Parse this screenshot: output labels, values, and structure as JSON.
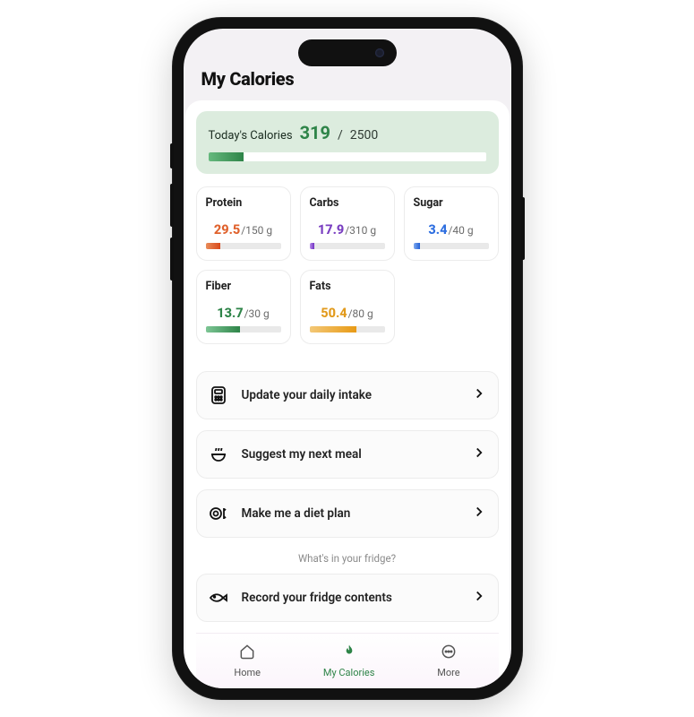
{
  "header": {
    "title": "My Calories"
  },
  "calories": {
    "label": "Today's Calories",
    "value": "319",
    "separator": "/",
    "total": "2500",
    "percent": 12.8
  },
  "nutrients": [
    {
      "name": "Protein",
      "current": "29.5",
      "target": "150",
      "unit": "g",
      "percent": 20,
      "color": "c-orange"
    },
    {
      "name": "Carbs",
      "current": "17.9",
      "target": "310",
      "unit": "g",
      "percent": 6,
      "color": "c-purple"
    },
    {
      "name": "Sugar",
      "current": "3.4",
      "target": "40",
      "unit": "g",
      "percent": 9,
      "color": "c-blue"
    },
    {
      "name": "Fiber",
      "current": "13.7",
      "target": "30",
      "unit": "g",
      "percent": 46,
      "color": "c-green"
    },
    {
      "name": "Fats",
      "current": "50.4",
      "target": "80",
      "unit": "g",
      "percent": 63,
      "color": "c-amber"
    }
  ],
  "actions": [
    {
      "id": "update-intake",
      "icon": "calculator-icon",
      "label": "Update your daily intake"
    },
    {
      "id": "suggest-meal",
      "icon": "meal-icon",
      "label": "Suggest my next meal"
    },
    {
      "id": "diet-plan",
      "icon": "plan-icon",
      "label": "Make me a diet plan"
    }
  ],
  "fridge": {
    "caption": "What's in your fridge?",
    "action": {
      "id": "record-fridge",
      "icon": "fish-icon",
      "label": "Record your fridge contents"
    }
  },
  "tabs": [
    {
      "id": "home",
      "label": "Home",
      "active": false
    },
    {
      "id": "calories",
      "label": "My Calories",
      "active": true
    },
    {
      "id": "more",
      "label": "More",
      "active": false
    }
  ]
}
